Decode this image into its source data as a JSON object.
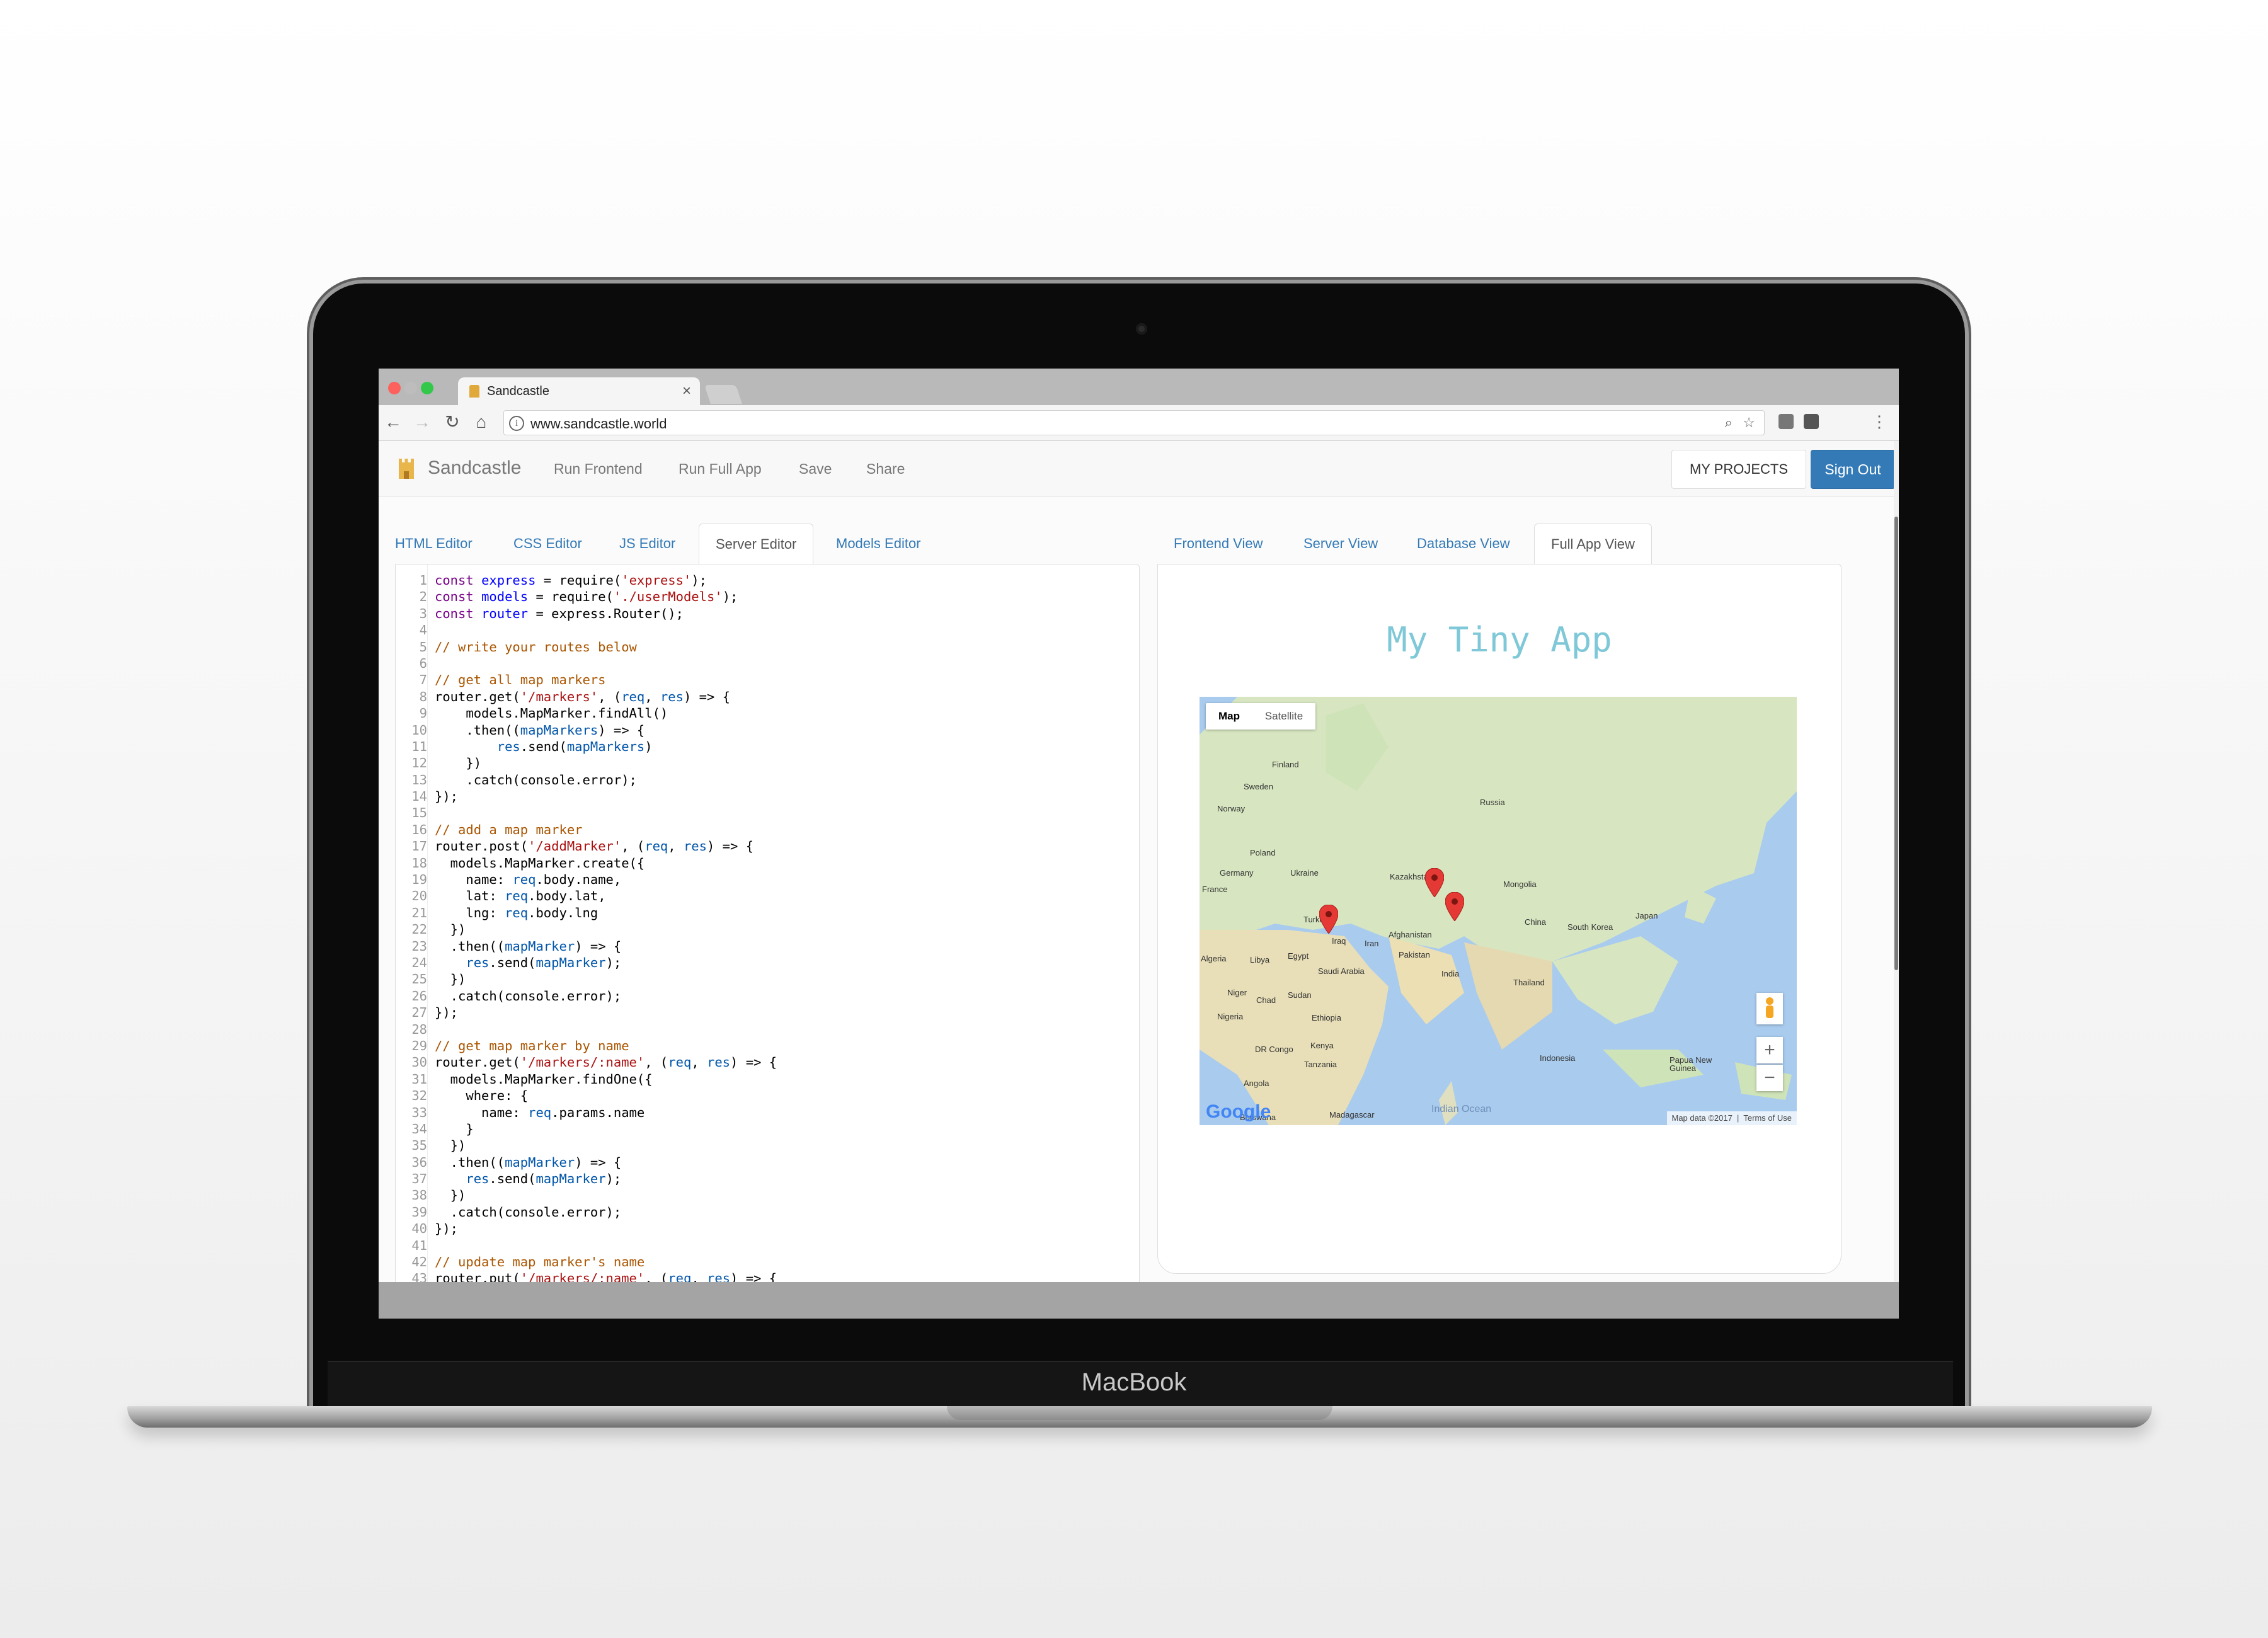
{
  "device": {
    "brand_label": "MacBook"
  },
  "browser": {
    "tab_title": "Sandcastle",
    "tab_close": "×",
    "url": "www.sandcastle.world",
    "back": "←",
    "forward": "→",
    "reload": "↻",
    "home": "⌂",
    "info": "i"
  },
  "navbar": {
    "logo_text": "Sandcastle",
    "links": [
      "Run Frontend",
      "Run Full App",
      "Save",
      "Share"
    ],
    "my_projects": "MY PROJECTS",
    "sign_out": "Sign Out"
  },
  "editor_tabs": [
    "HTML Editor",
    "CSS Editor",
    "JS Editor",
    "Server Editor",
    "Models Editor"
  ],
  "active_editor_tab": "Server Editor",
  "view_tabs": [
    "Frontend View",
    "Server View",
    "Database View",
    "Full App View"
  ],
  "active_view_tab": "Full App View",
  "code_lines": [
    "const express = require('express');",
    "const models = require('./userModels');",
    "const router = express.Router();",
    "",
    "// write your routes below",
    "",
    "// get all map markers",
    "router.get('/markers', (req, res) => {",
    "    models.MapMarker.findAll()",
    "    .then((mapMarkers) => {",
    "        res.send(mapMarkers)",
    "    })",
    "    .catch(console.error);",
    "});",
    "",
    "// add a map marker",
    "router.post('/addMarker', (req, res) => {",
    "  models.MapMarker.create({",
    "    name: req.body.name,",
    "    lat: req.body.lat,",
    "    lng: req.body.lng",
    "  })",
    "  .then((mapMarker) => {",
    "    res.send(mapMarker);",
    "  })",
    "  .catch(console.error);",
    "});",
    "",
    "// get map marker by name",
    "router.get('/markers/:name', (req, res) => {",
    "  models.MapMarker.findOne({",
    "    where: {",
    "      name: req.params.name",
    "    }",
    "  })",
    "  .then((mapMarker) => {",
    "    res.send(mapMarker);",
    "  })",
    "  .catch(console.error);",
    "});",
    "",
    "// update map marker's name",
    "router.put('/markers/:name', (req, res) => {"
  ],
  "preview": {
    "app_title": "My Tiny App",
    "map": {
      "type_map": "Map",
      "type_satellite": "Satellite",
      "zoom_in": "+",
      "zoom_out": "−",
      "attribution": "Map data ©2017",
      "terms": "Terms of Use",
      "google": "Google",
      "labels": [
        "Finland",
        "Sweden",
        "Norway",
        "Russia",
        "Poland",
        "Germany",
        "France",
        "Ukraine",
        "Kazakhstan",
        "Mongolia",
        "Turkey",
        "Iraq",
        "Iran",
        "Afghanistan",
        "Pakistan",
        "China",
        "South Korea",
        "Japan",
        "India",
        "Thailand",
        "Algeria",
        "Libya",
        "Egypt",
        "Saudi Arabia",
        "Niger",
        "Chad",
        "Sudan",
        "Nigeria",
        "Ethiopia",
        "DR Congo",
        "Kenya",
        "Tanzania",
        "Angola",
        "Indonesia",
        "Papua New Guinea",
        "Madagascar",
        "Botswana",
        "Indian Ocean"
      ]
    }
  }
}
